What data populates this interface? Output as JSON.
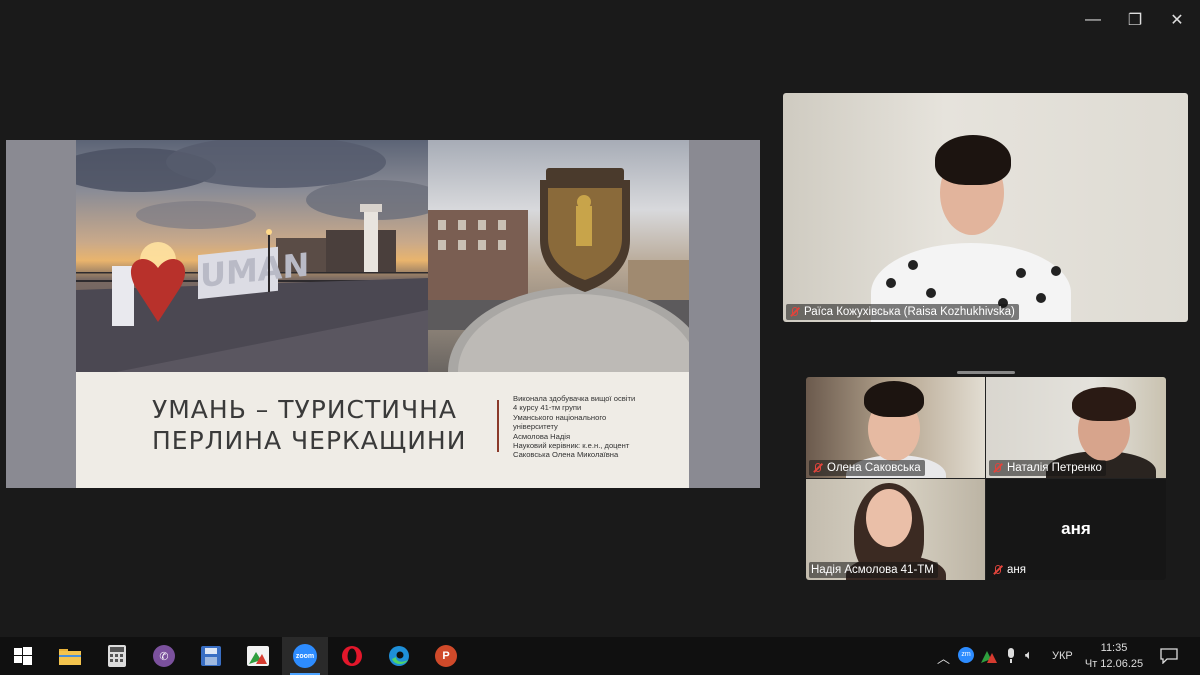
{
  "window": {
    "minimize_glyph": "—",
    "maximize_glyph": "❐",
    "close_glyph": "✕"
  },
  "slide": {
    "sign_text": "UMAN",
    "title_line1": "УМАНЬ – ТУРИСТИЧНА",
    "title_line2": "ПЕРЛИНА ЧЕРКАЩИНИ",
    "credits": [
      "Виконала здобувачка вищої освіти",
      "4 курсу 41-тм групи",
      "Уманського національного",
      "університету",
      "Асмолова Надія",
      "Науковий керівник: к.е.н., доцент",
      "Саковська Олена Миколаївна"
    ]
  },
  "participants": {
    "main": {
      "name": "Раїса Кожухівська (Raisa Kozhukhivska)",
      "muted": true
    },
    "gallery": [
      {
        "name": "Олена Саковська",
        "muted": true
      },
      {
        "name": "Наталія Петренко",
        "muted": true
      },
      {
        "name": "Надія Асмолова 41-ТМ",
        "muted": false
      },
      {
        "name": "аня",
        "avatar_text": "аня",
        "muted": true
      }
    ]
  },
  "taskbar": {
    "apps": [
      {
        "name": "start",
        "icon": "windows-icon"
      },
      {
        "name": "file-explorer",
        "icon": "folder-icon"
      },
      {
        "name": "calculator",
        "icon": "calculator-icon"
      },
      {
        "name": "viber",
        "icon": "viber-icon"
      },
      {
        "name": "save",
        "icon": "floppy-icon"
      },
      {
        "name": "photo-app",
        "icon": "photo-icon"
      },
      {
        "name": "zoom",
        "icon": "zoom-icon",
        "label": "zoom",
        "active": true
      },
      {
        "name": "opera",
        "icon": "opera-icon"
      },
      {
        "name": "edge",
        "icon": "edge-icon"
      },
      {
        "name": "powerpoint",
        "icon": "powerpoint-icon",
        "label": "P"
      }
    ],
    "tray": {
      "language": "УКР",
      "time": "11:35",
      "date": "Чт 12.06.25",
      "zoom_tray_label": "zm"
    }
  },
  "colors": {
    "share_background": "#8a8a92",
    "mute_red": "#e0443c",
    "taskbar_bg": "#101010",
    "active_underline": "#4da3ff",
    "slide_divider": "#8b3a2a"
  }
}
